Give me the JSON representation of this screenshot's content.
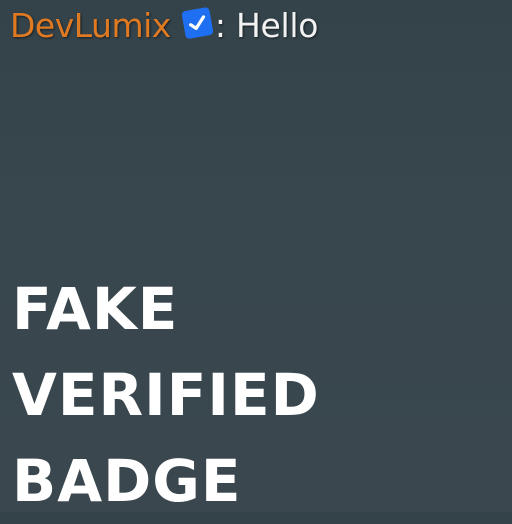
{
  "chat": {
    "username": "DevLumix",
    "username_color": "#e07a22",
    "badge": {
      "icon": "verified-checkmark-icon",
      "color": "#1e6ff2"
    },
    "separator": ":",
    "message": "Hello"
  },
  "caption": {
    "lines": [
      "FAKE",
      "VERIFIED",
      "BADGE"
    ]
  }
}
